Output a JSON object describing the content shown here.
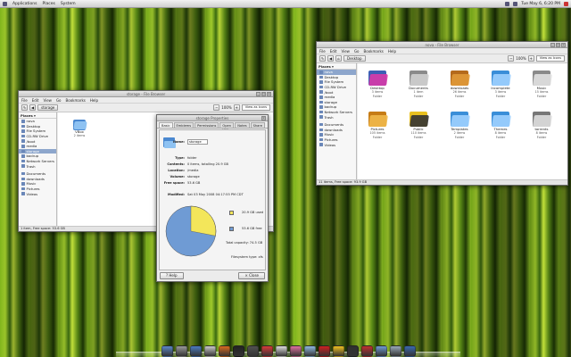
{
  "topbar": {
    "menus": [
      "Applications",
      "Places",
      "System"
    ],
    "clock": "Tue May  6,  6:20 PM"
  },
  "storage_window": {
    "title": "storage - File Browser",
    "menus": [
      "File",
      "Edit",
      "View",
      "Go",
      "Bookmarks",
      "Help"
    ],
    "path_button": "storage",
    "zoom": "100%",
    "view_mode": "View as Icons",
    "places_label": "Places",
    "places": [
      "nova",
      "Desktop",
      "File System",
      "CD-RW Drive",
      "/boot",
      "media",
      "storage",
      "backup",
      "Network Servers",
      "Trash",
      "Documents",
      "downloads",
      "Music",
      "Pictures",
      "Videos"
    ],
    "selected_place": "storage",
    "folder": {
      "name": "VBox",
      "sub": "2 items"
    },
    "status": "1 item, Free space: 53.6 GB"
  },
  "properties_dialog": {
    "title": "storage Properties",
    "tabs": [
      "Basic",
      "Emblems",
      "Permissions",
      "Open With",
      "Notes",
      "Share"
    ],
    "active_tab": "Basic",
    "rows": [
      {
        "key": "Name:",
        "value": "storage"
      },
      {
        "key": "Type:",
        "value": "folder"
      },
      {
        "key": "Contents:",
        "value": "0 items, totalling 20.9 GB"
      },
      {
        "key": "Location:",
        "value": "/media"
      },
      {
        "key": "Volume:",
        "value": "storage"
      },
      {
        "key": "Free space:",
        "value": "53.6 GB"
      },
      {
        "key": "Modified:",
        "value": "Sat 03 May 2008 04:17:55 PM CDT"
      }
    ],
    "disk_usage": {
      "used_label": "20.9 GB used",
      "free_label": "53.6 GB free",
      "total_capacity": "Total capacity: 74.5 GB",
      "filesystem_type": "Filesystem type: xfs",
      "used_fraction": 0.28,
      "used_color": "#f3e65a",
      "free_color": "#6f9bd4"
    },
    "help_button": "Help",
    "close_button": "Close"
  },
  "home_window": {
    "title": "nova - File Browser",
    "menus": [
      "File",
      "Edit",
      "View",
      "Go",
      "Bookmarks",
      "Help"
    ],
    "path_button": "Desktop",
    "zoom": "100%",
    "view_mode": "View as Icons",
    "places_label": "Places",
    "places": [
      "nova",
      "Desktop",
      "File System",
      "CD-RW Drive",
      "/boot",
      "media",
      "storage",
      "backup",
      "Network Servers",
      "Trash",
      "Documents",
      "downloads",
      "Music",
      "Pictures",
      "Videos"
    ],
    "selected_place": "nova",
    "folders": [
      {
        "name": "Desktop",
        "sub1": "3 items",
        "sub2": "Folder",
        "color": "#3c5fb5",
        "accent": "#d73aa8"
      },
      {
        "name": "Documents",
        "sub1": "1 item",
        "sub2": "Folder",
        "color": "#8a8a8a",
        "accent": "#cfcfcf"
      },
      {
        "name": "downloads",
        "sub1": "26 items",
        "sub2": "Folder",
        "color": "#b46a1c",
        "accent": "#e09a3a"
      },
      {
        "name": "Incomplete",
        "sub1": "3 items",
        "sub2": "Folder",
        "color": "#3a8ed8",
        "accent": "#9fd0ff"
      },
      {
        "name": "Music",
        "sub1": "15 items",
        "sub2": "Folder",
        "color": "#8a8a8a",
        "accent": "#e0e0e0"
      },
      {
        "name": "Pictures",
        "sub1": "105 items",
        "sub2": "Folder",
        "color": "#c67c16",
        "accent": "#f0b84a"
      },
      {
        "name": "Public",
        "sub1": "110 items",
        "sub2": "Folder",
        "color": "#e8c020",
        "accent": "#333333"
      },
      {
        "name": "Templates",
        "sub1": "2 items",
        "sub2": "Folder",
        "color": "#3a8ed8",
        "accent": "#9fd0ff"
      },
      {
        "name": "Themes",
        "sub1": "8 items",
        "sub2": "Folder",
        "color": "#3a8ed8",
        "accent": "#9fd0ff"
      },
      {
        "name": "torrents",
        "sub1": "8 items",
        "sub2": "Folder",
        "color": "#777777",
        "accent": "#dddddd"
      }
    ],
    "status": "11 items, Free space: 93.9 GB"
  },
  "dock": {
    "icons": [
      {
        "name": "finder-icon",
        "color": "#5b86c8"
      },
      {
        "name": "system-icon",
        "color": "#9a9a9a"
      },
      {
        "name": "network-icon",
        "color": "#4a7ac0"
      },
      {
        "name": "mail-icon",
        "color": "#c9c9c9"
      },
      {
        "name": "firefox-icon",
        "color": "#d86a1e"
      },
      {
        "name": "terminal-icon",
        "color": "#222222"
      },
      {
        "name": "media-icon",
        "color": "#505050"
      },
      {
        "name": "chat-icon",
        "color": "#d83a3a"
      },
      {
        "name": "games-icon",
        "color": "#dddddd"
      },
      {
        "name": "pidgin-icon",
        "color": "#e070a0"
      },
      {
        "name": "tools-icon",
        "color": "#8fb8e0"
      },
      {
        "name": "music-icon",
        "color": "#d02020"
      },
      {
        "name": "burn-icon",
        "color": "#f0c020"
      },
      {
        "name": "monitor-icon",
        "color": "#303030"
      },
      {
        "name": "power-icon",
        "color": "#c03030"
      },
      {
        "name": "folder-icon",
        "color": "#6f9bd4"
      },
      {
        "name": "trash-icon",
        "color": "#9aa8b8"
      },
      {
        "name": "screen-icon",
        "color": "#3a6ab0"
      }
    ]
  }
}
